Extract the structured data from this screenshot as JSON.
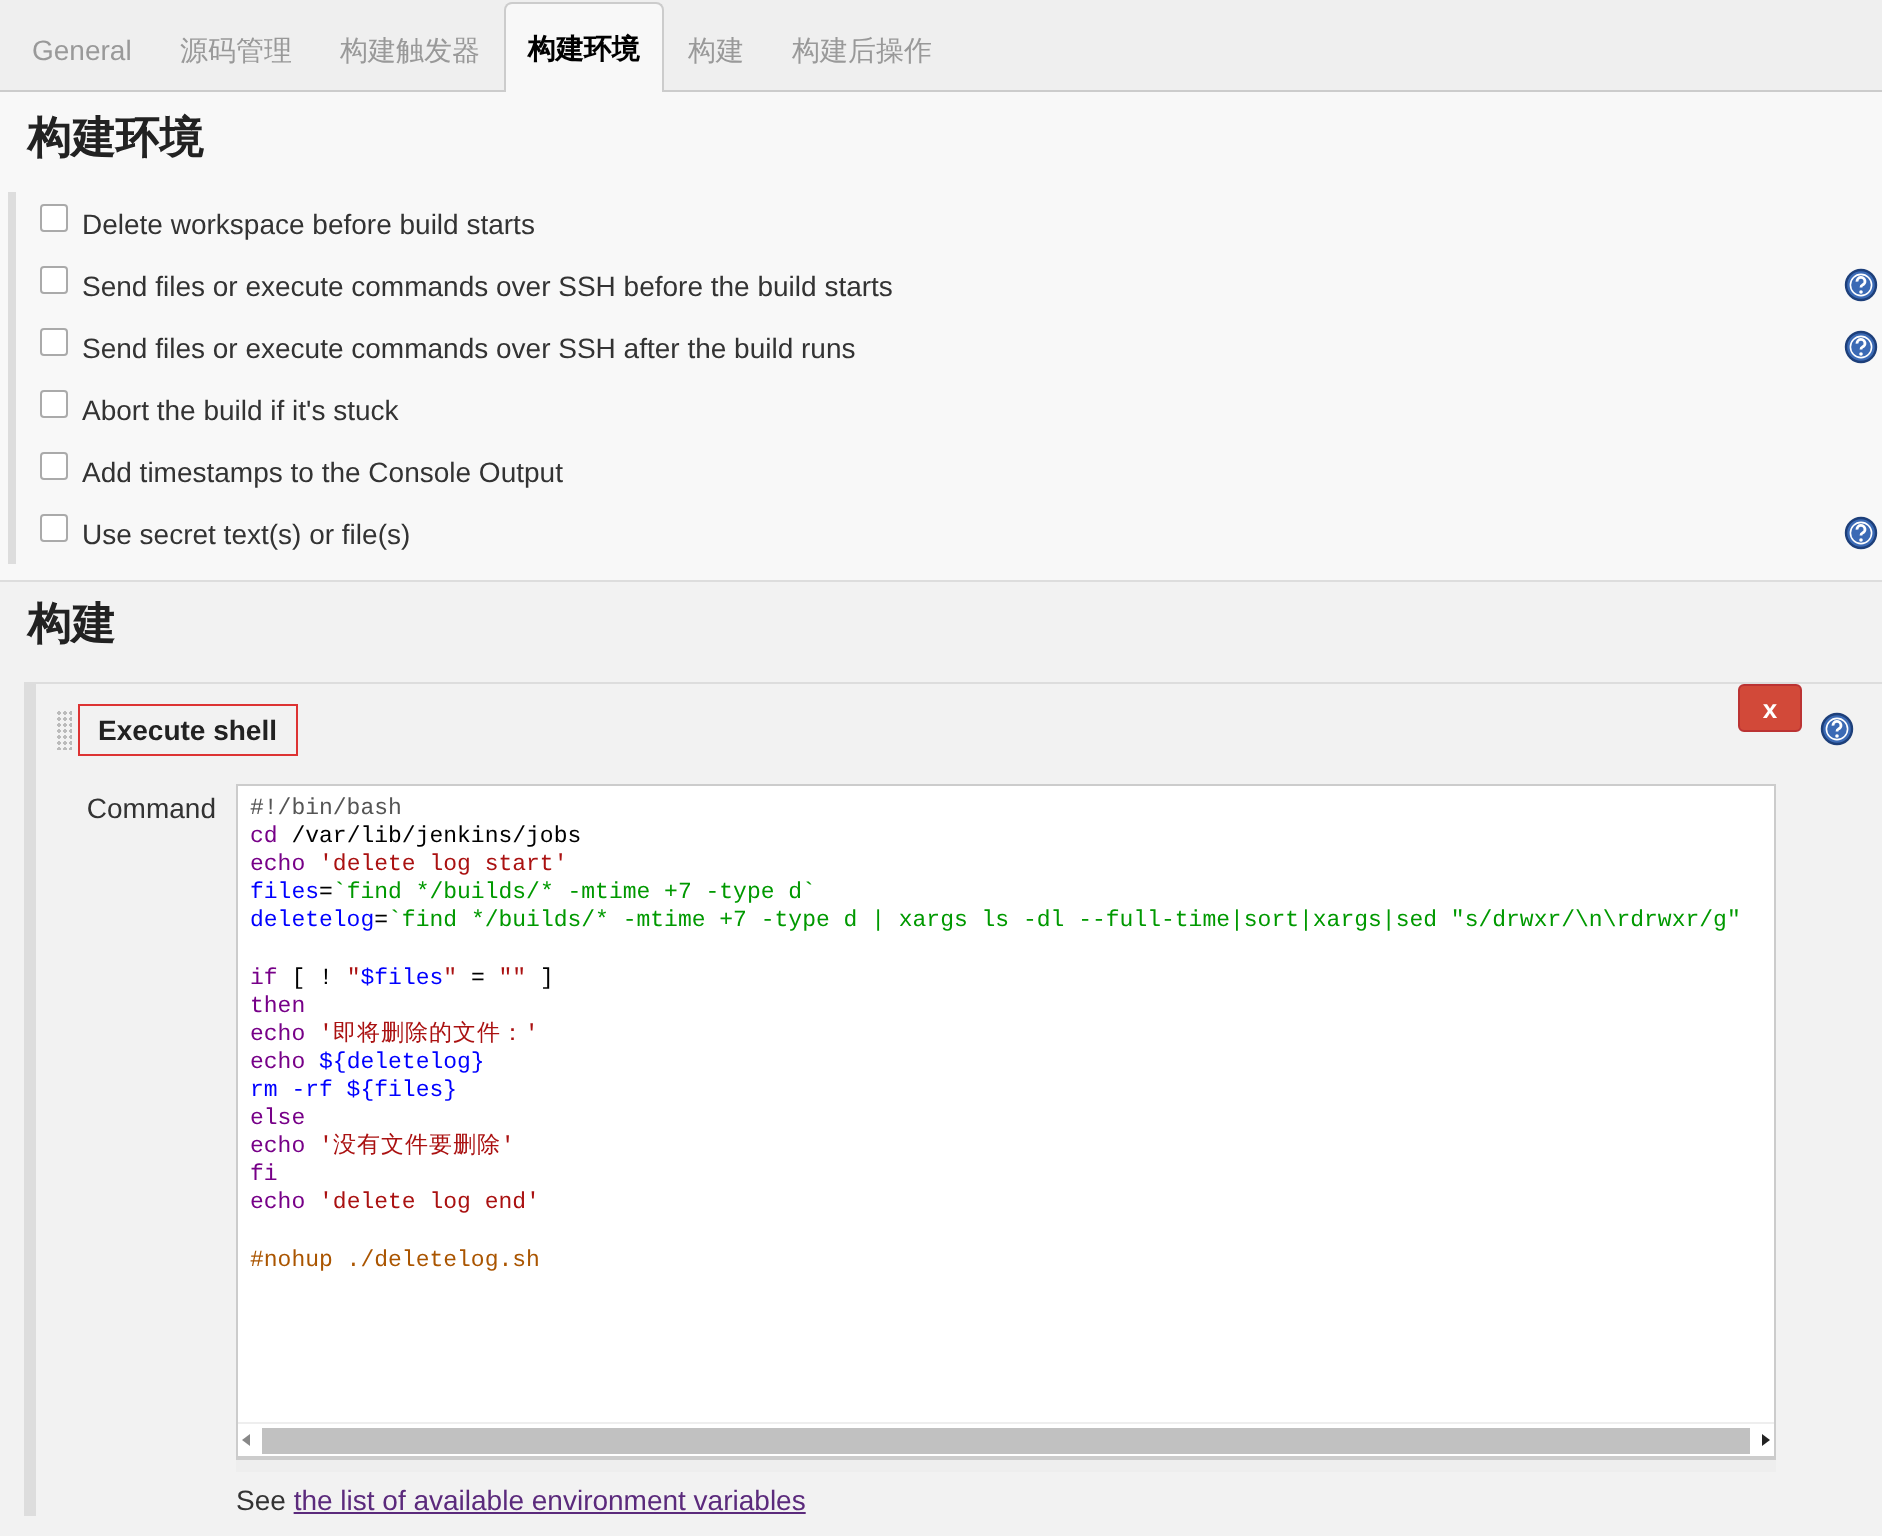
{
  "tabs": [
    {
      "label": "General",
      "selected": false
    },
    {
      "label": "源码管理",
      "selected": false
    },
    {
      "label": "构建触发器",
      "selected": false
    },
    {
      "label": "构建环境",
      "selected": true
    },
    {
      "label": "构建",
      "selected": false
    },
    {
      "label": "构建后操作",
      "selected": false
    }
  ],
  "build_environment": {
    "heading": "构建环境",
    "options": [
      {
        "label": "Delete workspace before build starts",
        "checked": false,
        "help": false
      },
      {
        "label": "Send files or execute commands over SSH before the build starts",
        "checked": false,
        "help": true
      },
      {
        "label": "Send files or execute commands over SSH after the build runs",
        "checked": false,
        "help": true
      },
      {
        "label": "Abort the build if it's stuck",
        "checked": false,
        "help": false
      },
      {
        "label": "Add timestamps to the Console Output",
        "checked": false,
        "help": false
      },
      {
        "label": "Use secret text(s) or file(s)",
        "checked": false,
        "help": true
      }
    ]
  },
  "build": {
    "heading": "构建",
    "step": {
      "title": "Execute shell",
      "delete_button": "x",
      "command_label": "Command",
      "lines": [
        {
          "gap_before": false,
          "tokens": [
            {
              "kind": "comment",
              "text": "#!/bin/bash"
            }
          ]
        },
        {
          "gap_before": false,
          "tokens": [
            {
              "kind": "keyword",
              "text": "cd"
            },
            {
              "kind": "plain",
              "text": " /var/lib/jenkins/jobs"
            }
          ]
        },
        {
          "gap_before": false,
          "tokens": [
            {
              "kind": "keyword",
              "text": "echo"
            },
            {
              "kind": "string",
              "text": " 'delete log start'"
            }
          ]
        },
        {
          "gap_before": false,
          "tokens": [
            {
              "kind": "variable",
              "text": "files"
            },
            {
              "kind": "plain",
              "text": "="
            },
            {
              "kind": "command",
              "text": "`find */builds/* -mtime +7 -type d`"
            }
          ]
        },
        {
          "gap_before": false,
          "tokens": [
            {
              "kind": "variable",
              "text": "deletelog"
            },
            {
              "kind": "plain",
              "text": "="
            },
            {
              "kind": "command",
              "text": "`find */builds/* -mtime +7 -type d | xargs ls -dl --full-time|sort|xargs|sed \"s/drwxr/\\n\\rdrwxr/g\""
            }
          ]
        },
        {
          "gap_before": true,
          "tokens": [
            {
              "kind": "keyword",
              "text": "if"
            },
            {
              "kind": "plain",
              "text": " [ ! "
            },
            {
              "kind": "string",
              "text": "\""
            },
            {
              "kind": "variable",
              "text": "$files"
            },
            {
              "kind": "string",
              "text": "\""
            },
            {
              "kind": "plain",
              "text": " = "
            },
            {
              "kind": "string",
              "text": "\"\""
            },
            {
              "kind": "plain",
              "text": " ]"
            }
          ]
        },
        {
          "gap_before": false,
          "tokens": [
            {
              "kind": "keyword",
              "text": "then"
            }
          ]
        },
        {
          "gap_before": false,
          "tokens": [
            {
              "kind": "keyword",
              "text": "echo"
            },
            {
              "kind": "string",
              "text": " '即将删除的文件：'"
            }
          ]
        },
        {
          "gap_before": false,
          "tokens": [
            {
              "kind": "keyword",
              "text": "echo"
            },
            {
              "kind": "variable",
              "text": " ${deletelog}"
            }
          ]
        },
        {
          "gap_before": false,
          "tokens": [
            {
              "kind": "variable",
              "text": "rm -rf ${files}"
            }
          ]
        },
        {
          "gap_before": false,
          "tokens": [
            {
              "kind": "keyword",
              "text": "else"
            }
          ]
        },
        {
          "gap_before": false,
          "tokens": [
            {
              "kind": "keyword",
              "text": "echo"
            },
            {
              "kind": "string",
              "text": " '没有文件要删除'"
            }
          ]
        },
        {
          "gap_before": false,
          "tokens": [
            {
              "kind": "keyword",
              "text": "fi"
            }
          ]
        },
        {
          "gap_before": false,
          "tokens": [
            {
              "kind": "keyword",
              "text": "echo"
            },
            {
              "kind": "string",
              "text": " 'delete log end'"
            }
          ]
        },
        {
          "gap_before": true,
          "tokens": [
            {
              "kind": "note",
              "text": "#nohup ./deletelog.sh"
            }
          ]
        }
      ],
      "see_prefix": "See",
      "see_link": "the list of available environment variables"
    }
  }
}
